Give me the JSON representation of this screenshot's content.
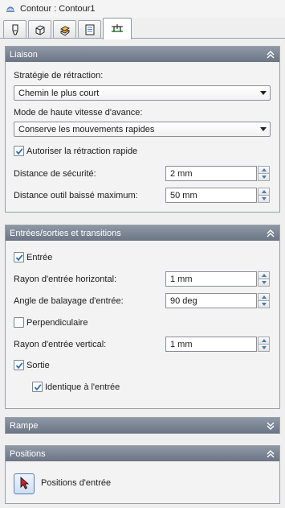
{
  "window": {
    "title": "Contour : Contour1"
  },
  "tabs": [
    {
      "icon": "tool-icon"
    },
    {
      "icon": "stock-box-icon"
    },
    {
      "icon": "layers-icon"
    },
    {
      "icon": "list-document-icon"
    },
    {
      "icon": "linking-icon",
      "active": true
    }
  ],
  "liaison": {
    "title": "Liaison",
    "retract_strategy_label": "Stratégie de rétraction:",
    "retract_strategy_value": "Chemin le plus court",
    "high_feed_label": "Mode de haute vitesse d'avance:",
    "high_feed_value": "Conserve les mouvements rapides",
    "rapid_retract_label": "Autoriser la rétraction rapide",
    "rapid_retract_checked": true,
    "safe_distance_label": "Distance de sécurité:",
    "safe_distance_value": "2 mm",
    "max_stay_down_label": "Distance outil baissé maximum:",
    "max_stay_down_value": "50 mm"
  },
  "leads": {
    "title": "Entrées/sorties et transitions",
    "entry_label": "Entrée",
    "entry_checked": true,
    "h_radius_label": "Rayon d'entrée horizontal:",
    "h_radius_value": "1 mm",
    "sweep_label": "Angle de balayage d'entrée:",
    "sweep_value": "90 deg",
    "perp_label": "Perpendiculaire",
    "perp_checked": false,
    "v_radius_label": "Rayon d'entrée vertical:",
    "v_radius_value": "1 mm",
    "exit_label": "Sortie",
    "exit_checked": true,
    "same_as_entry_label": "Identique à l'entrée",
    "same_as_entry_checked": true
  },
  "ramp": {
    "title": "Rampe"
  },
  "positions": {
    "title": "Positions",
    "entry_positions_label": "Positions d'entrée"
  },
  "colors": {
    "header_top": "#8f98a6",
    "header_bottom": "#6b7585",
    "check_mark": "#2f6fb3",
    "accent": "#4a79b6"
  }
}
